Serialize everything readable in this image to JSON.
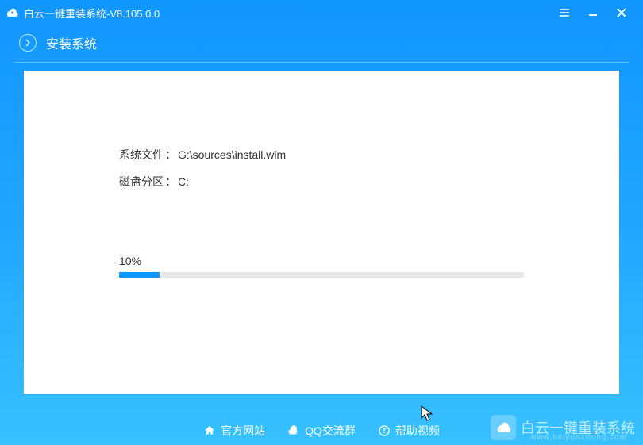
{
  "titlebar": {
    "title": "白云一键重装系统-V8.105.0.0"
  },
  "subheader": {
    "title": "安装系统"
  },
  "info": {
    "sys_label": "系统文件",
    "sys_value": "G:\\sources\\install.wim",
    "disk_label": "磁盘分区",
    "disk_value": "C:",
    "separator": "："
  },
  "progress": {
    "percent_text": "10%",
    "percent_value": 10
  },
  "footer": {
    "official_site": "官方网站",
    "qq_group": "QQ交流群",
    "help_video": "帮助视频"
  },
  "watermark": {
    "text": "白云一键重装系统",
    "url": "www.baiyunxitong.com"
  }
}
